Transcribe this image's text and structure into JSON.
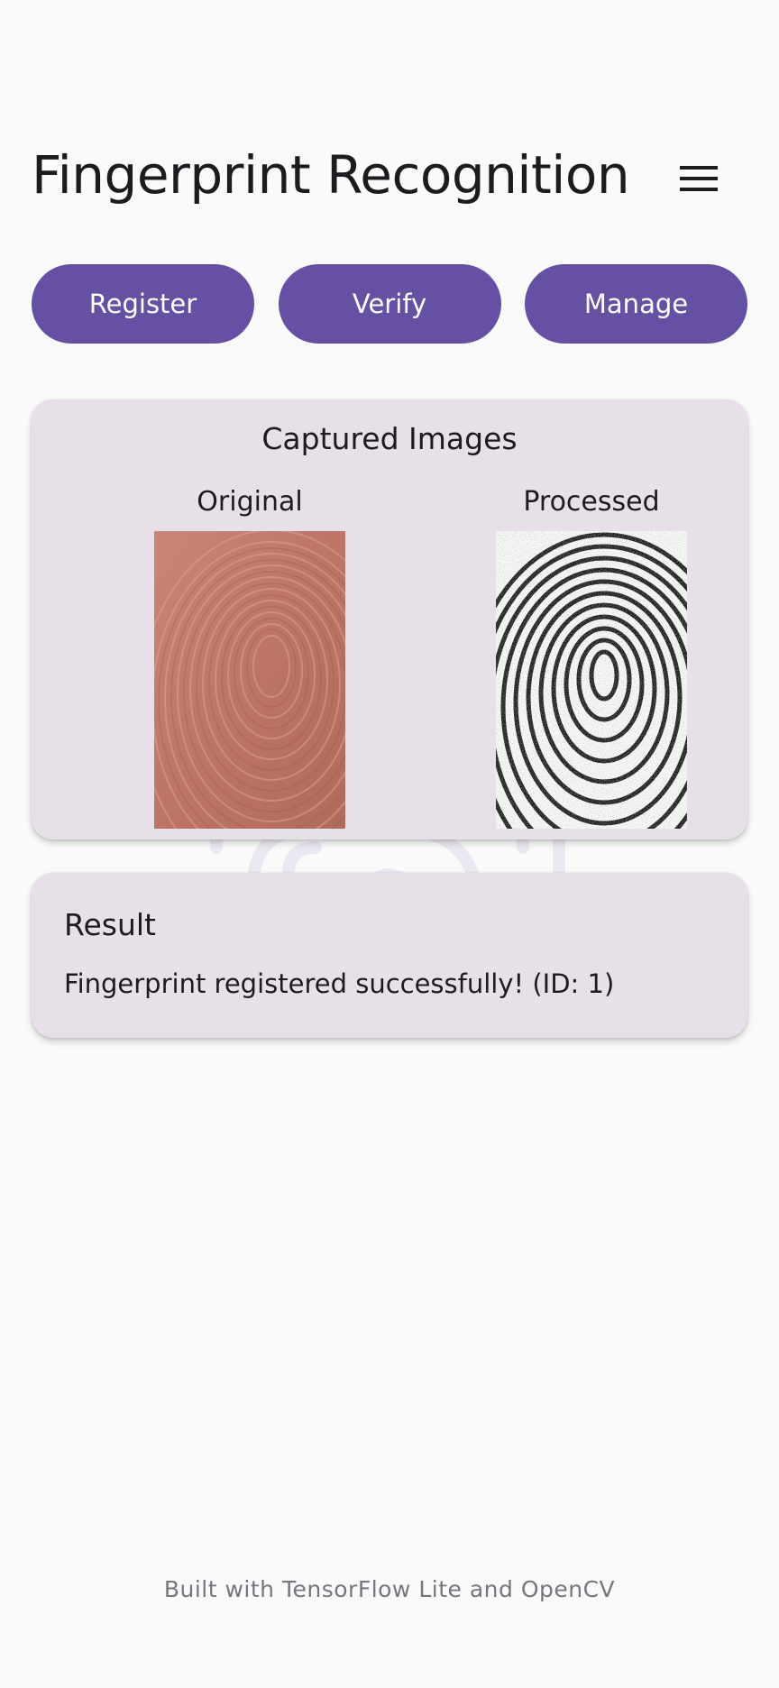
{
  "app": {
    "title": "Fingerprint Recognition",
    "menu_icon": "hamburger-menu-icon"
  },
  "actions": {
    "register_label": "Register",
    "verify_label": "Verify",
    "manage_label": "Manage",
    "button_color": "#6550a4"
  },
  "captured": {
    "title": "Captured Images",
    "original_label": "Original",
    "processed_label": "Processed"
  },
  "result": {
    "title": "Result",
    "message": "Fingerprint registered successfully! (ID: 1)"
  },
  "footer": {
    "text": "Built with TensorFlow Lite and OpenCV"
  },
  "colors": {
    "background": "#fafafa",
    "card": "#e7e0e8",
    "accent": "#6550a4",
    "footer_text": "#79747e"
  }
}
